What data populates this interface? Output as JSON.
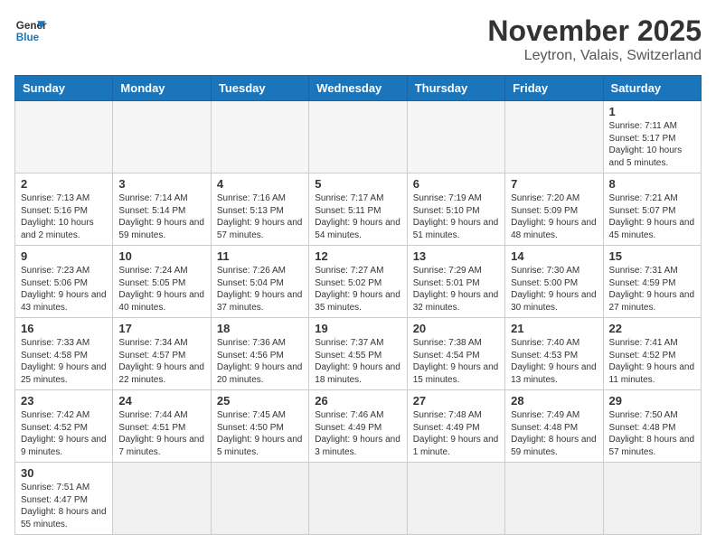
{
  "header": {
    "logo_general": "General",
    "logo_blue": "Blue",
    "title": "November 2025",
    "subtitle": "Leytron, Valais, Switzerland"
  },
  "days_of_week": [
    "Sunday",
    "Monday",
    "Tuesday",
    "Wednesday",
    "Thursday",
    "Friday",
    "Saturday"
  ],
  "weeks": [
    [
      {
        "day": "",
        "info": ""
      },
      {
        "day": "",
        "info": ""
      },
      {
        "day": "",
        "info": ""
      },
      {
        "day": "",
        "info": ""
      },
      {
        "day": "",
        "info": ""
      },
      {
        "day": "",
        "info": ""
      },
      {
        "day": "1",
        "info": "Sunrise: 7:11 AM\nSunset: 5:17 PM\nDaylight: 10 hours and 5 minutes."
      }
    ],
    [
      {
        "day": "2",
        "info": "Sunrise: 7:13 AM\nSunset: 5:16 PM\nDaylight: 10 hours and 2 minutes."
      },
      {
        "day": "3",
        "info": "Sunrise: 7:14 AM\nSunset: 5:14 PM\nDaylight: 9 hours and 59 minutes."
      },
      {
        "day": "4",
        "info": "Sunrise: 7:16 AM\nSunset: 5:13 PM\nDaylight: 9 hours and 57 minutes."
      },
      {
        "day": "5",
        "info": "Sunrise: 7:17 AM\nSunset: 5:11 PM\nDaylight: 9 hours and 54 minutes."
      },
      {
        "day": "6",
        "info": "Sunrise: 7:19 AM\nSunset: 5:10 PM\nDaylight: 9 hours and 51 minutes."
      },
      {
        "day": "7",
        "info": "Sunrise: 7:20 AM\nSunset: 5:09 PM\nDaylight: 9 hours and 48 minutes."
      },
      {
        "day": "8",
        "info": "Sunrise: 7:21 AM\nSunset: 5:07 PM\nDaylight: 9 hours and 45 minutes."
      }
    ],
    [
      {
        "day": "9",
        "info": "Sunrise: 7:23 AM\nSunset: 5:06 PM\nDaylight: 9 hours and 43 minutes."
      },
      {
        "day": "10",
        "info": "Sunrise: 7:24 AM\nSunset: 5:05 PM\nDaylight: 9 hours and 40 minutes."
      },
      {
        "day": "11",
        "info": "Sunrise: 7:26 AM\nSunset: 5:04 PM\nDaylight: 9 hours and 37 minutes."
      },
      {
        "day": "12",
        "info": "Sunrise: 7:27 AM\nSunset: 5:02 PM\nDaylight: 9 hours and 35 minutes."
      },
      {
        "day": "13",
        "info": "Sunrise: 7:29 AM\nSunset: 5:01 PM\nDaylight: 9 hours and 32 minutes."
      },
      {
        "day": "14",
        "info": "Sunrise: 7:30 AM\nSunset: 5:00 PM\nDaylight: 9 hours and 30 minutes."
      },
      {
        "day": "15",
        "info": "Sunrise: 7:31 AM\nSunset: 4:59 PM\nDaylight: 9 hours and 27 minutes."
      }
    ],
    [
      {
        "day": "16",
        "info": "Sunrise: 7:33 AM\nSunset: 4:58 PM\nDaylight: 9 hours and 25 minutes."
      },
      {
        "day": "17",
        "info": "Sunrise: 7:34 AM\nSunset: 4:57 PM\nDaylight: 9 hours and 22 minutes."
      },
      {
        "day": "18",
        "info": "Sunrise: 7:36 AM\nSunset: 4:56 PM\nDaylight: 9 hours and 20 minutes."
      },
      {
        "day": "19",
        "info": "Sunrise: 7:37 AM\nSunset: 4:55 PM\nDaylight: 9 hours and 18 minutes."
      },
      {
        "day": "20",
        "info": "Sunrise: 7:38 AM\nSunset: 4:54 PM\nDaylight: 9 hours and 15 minutes."
      },
      {
        "day": "21",
        "info": "Sunrise: 7:40 AM\nSunset: 4:53 PM\nDaylight: 9 hours and 13 minutes."
      },
      {
        "day": "22",
        "info": "Sunrise: 7:41 AM\nSunset: 4:52 PM\nDaylight: 9 hours and 11 minutes."
      }
    ],
    [
      {
        "day": "23",
        "info": "Sunrise: 7:42 AM\nSunset: 4:52 PM\nDaylight: 9 hours and 9 minutes."
      },
      {
        "day": "24",
        "info": "Sunrise: 7:44 AM\nSunset: 4:51 PM\nDaylight: 9 hours and 7 minutes."
      },
      {
        "day": "25",
        "info": "Sunrise: 7:45 AM\nSunset: 4:50 PM\nDaylight: 9 hours and 5 minutes."
      },
      {
        "day": "26",
        "info": "Sunrise: 7:46 AM\nSunset: 4:49 PM\nDaylight: 9 hours and 3 minutes."
      },
      {
        "day": "27",
        "info": "Sunrise: 7:48 AM\nSunset: 4:49 PM\nDaylight: 9 hours and 1 minute."
      },
      {
        "day": "28",
        "info": "Sunrise: 7:49 AM\nSunset: 4:48 PM\nDaylight: 8 hours and 59 minutes."
      },
      {
        "day": "29",
        "info": "Sunrise: 7:50 AM\nSunset: 4:48 PM\nDaylight: 8 hours and 57 minutes."
      }
    ],
    [
      {
        "day": "30",
        "info": "Sunrise: 7:51 AM\nSunset: 4:47 PM\nDaylight: 8 hours and 55 minutes."
      },
      {
        "day": "",
        "info": ""
      },
      {
        "day": "",
        "info": ""
      },
      {
        "day": "",
        "info": ""
      },
      {
        "day": "",
        "info": ""
      },
      {
        "day": "",
        "info": ""
      },
      {
        "day": "",
        "info": ""
      }
    ]
  ]
}
